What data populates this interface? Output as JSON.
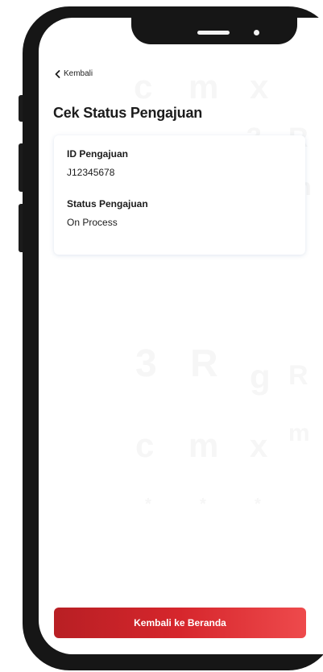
{
  "header": {
    "back_label": "Kembali",
    "back_icon": "chevron-left-icon"
  },
  "page": {
    "title": "Cek Status Pengajuan"
  },
  "card": {
    "id_label": "ID Pengajuan",
    "id_value": "J12345678",
    "status_label": "Status Pengajuan",
    "status_value": "On Process"
  },
  "footer": {
    "home_button_label": "Kembali ke Beranda"
  },
  "colors": {
    "primary_red": "#d6262c",
    "frame": "#161616",
    "text": "#1c1c1c"
  }
}
